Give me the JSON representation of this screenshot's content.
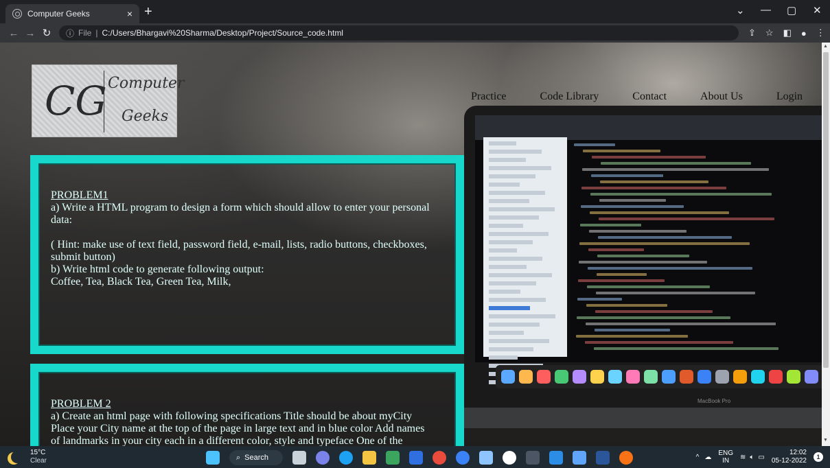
{
  "browser": {
    "tab_title": "Computer Geeks",
    "tab_close": "×",
    "new_tab": "+",
    "url_scheme": "File",
    "url": "C:/Users/Bhargavi%20Sharma/Desktop/Project/Source_code.html",
    "window_controls": [
      "⌄",
      "—",
      "▢",
      "✕"
    ]
  },
  "logo": {
    "monogram": "CG",
    "line1": "Computer",
    "line2": "Geeks"
  },
  "nav": {
    "items": [
      "Practice",
      "Code Library",
      "Contact",
      "About Us",
      "Login"
    ]
  },
  "laptop": {
    "brand": "MacBook Pro"
  },
  "problems": [
    {
      "title": "PROBLEM1",
      "lines": [
        "a) Write a HTML program to design a form which should allow to enter your personal",
        "data:",
        "",
        "( Hint: make use of text field, password field, e-mail, lists, radio buttons, checkboxes,",
        "submit button)",
        "b) Write html code to generate following output:",
        "Coffee, Tea, Black Tea, Green Tea, Milk,"
      ]
    },
    {
      "title": "PROBLEM 2",
      "lines": [
        "a) Create an html page with following specifications Title should be about myCity",
        "Place your City name at the top of the page in large text and in blue color Add names",
        "of landmarks in your city each in a different color, style and typeface One of the"
      ]
    }
  ],
  "taskbar": {
    "temperature": "15°C",
    "condition": "Clear",
    "search_label": "Search",
    "lang_top": "ENG",
    "lang_bottom": "IN",
    "time": "12:02",
    "date": "05-12-2022",
    "notifications": "1"
  },
  "colors": {
    "accent_border": "#17d8ca",
    "text": "#dffffb"
  }
}
